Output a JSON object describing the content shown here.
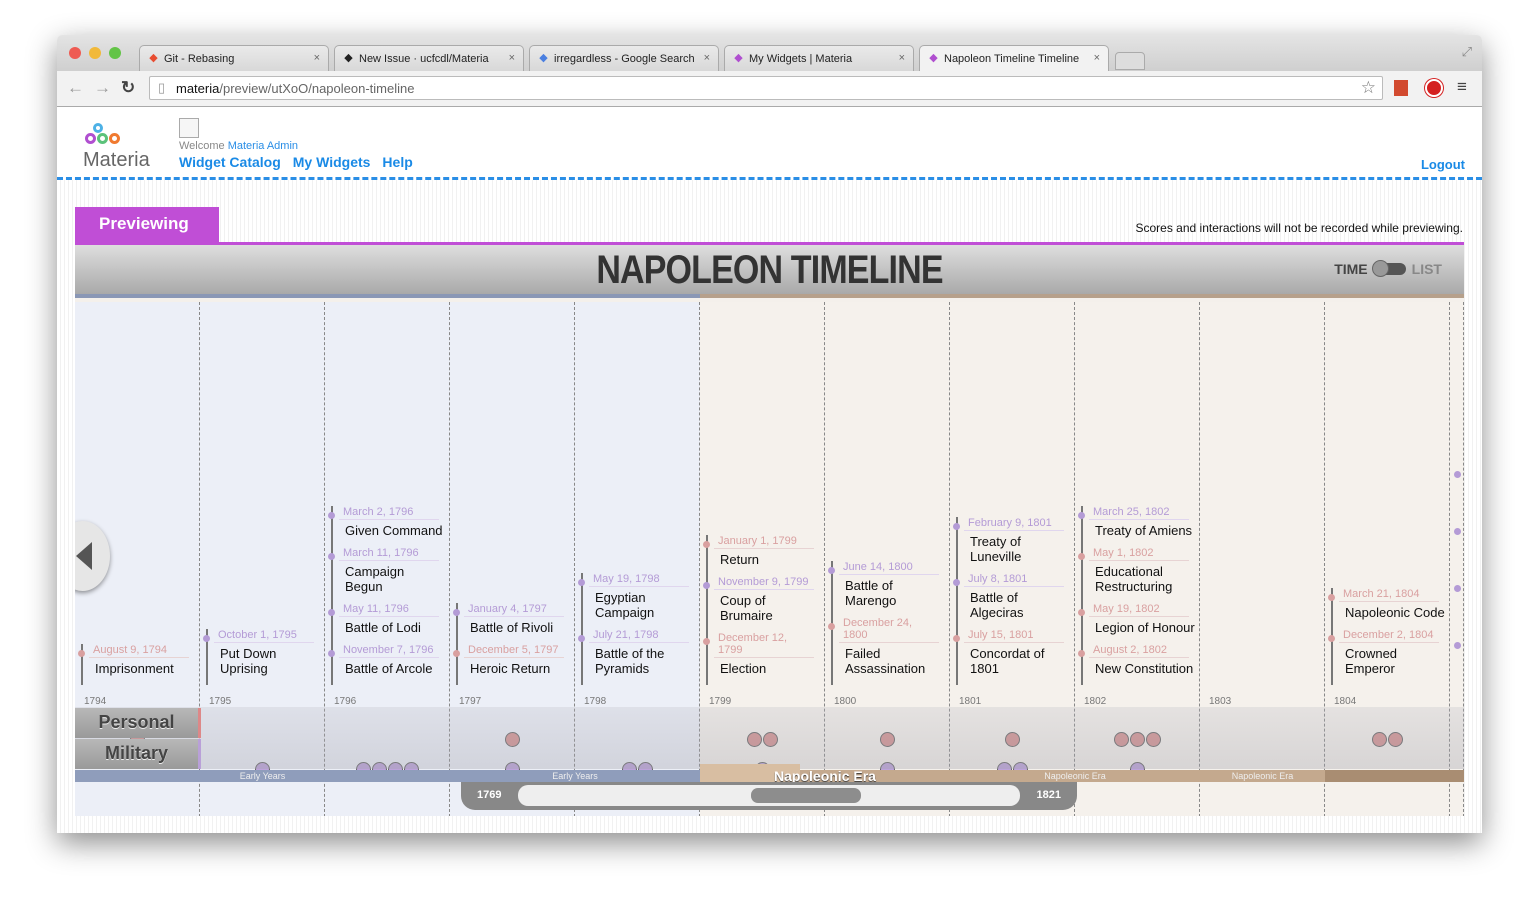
{
  "browser": {
    "tabs": [
      {
        "title": "Git - Rebasing",
        "icon": "git-icon",
        "color": "#e84d31"
      },
      {
        "title": "New Issue · ucfcdl/Materia",
        "icon": "github-icon",
        "color": "#222"
      },
      {
        "title": "irregardless - Google Search",
        "icon": "google-icon",
        "color": "#4a7fe0"
      },
      {
        "title": "My Widgets | Materia",
        "icon": "materia-icon",
        "color": "#b04fd0"
      },
      {
        "title": "Napoleon Timeline Timeline",
        "icon": "materia-icon",
        "color": "#b04fd0"
      }
    ],
    "url_host": "materia",
    "url_path": "/preview/utXoO/napoleon-timeline"
  },
  "site": {
    "logo": "Materia",
    "welcome": "Welcome",
    "user": "Materia Admin",
    "nav": [
      "Widget Catalog",
      "My Widgets",
      "Help"
    ],
    "logout": "Logout",
    "previewing": "Previewing",
    "preview_note": "Scores and interactions will not be recorded while previewing."
  },
  "widget": {
    "title": "NAPOLEON TIMELINE",
    "toggle_time": "TIME",
    "toggle_list": "LIST",
    "row_personal": "Personal",
    "row_military": "Military",
    "colors": {
      "personal": "#d59393",
      "military": "#bda3db",
      "early": "#8f9dbb",
      "napoleonic": "#c4a98e"
    },
    "years": [
      {
        "year": "1794",
        "era": "early",
        "events": [
          {
            "date": "August 9, 1794",
            "title": "Imprisonment",
            "type": "personal"
          }
        ]
      },
      {
        "year": "1795",
        "era": "early",
        "events": [
          {
            "date": "October 1, 1795",
            "title": "Put Down Uprising",
            "type": "military"
          }
        ]
      },
      {
        "year": "1796",
        "era": "early",
        "events": [
          {
            "date": "March 2, 1796",
            "title": "Given Command",
            "type": "military"
          },
          {
            "date": "March 11, 1796",
            "title": "Campaign Begun",
            "type": "military"
          },
          {
            "date": "May 11, 1796",
            "title": "Battle of Lodi",
            "type": "military"
          },
          {
            "date": "November 7, 1796",
            "title": "Battle of Arcole",
            "type": "military"
          }
        ]
      },
      {
        "year": "1797",
        "era": "early",
        "events": [
          {
            "date": "January 4, 1797",
            "title": "Battle of Rivoli",
            "type": "military"
          },
          {
            "date": "December 5, 1797",
            "title": "Heroic Return",
            "type": "personal"
          }
        ]
      },
      {
        "year": "1798",
        "era": "early",
        "events": [
          {
            "date": "May 19, 1798",
            "title": "Egyptian Campaign",
            "type": "military"
          },
          {
            "date": "July 21, 1798",
            "title": "Battle of the Pyramids",
            "type": "military"
          }
        ]
      },
      {
        "year": "1799",
        "era": "nap",
        "events": [
          {
            "date": "January 1, 1799",
            "title": "Return",
            "type": "personal"
          },
          {
            "date": "November 9, 1799",
            "title": "Coup of Brumaire",
            "type": "military"
          },
          {
            "date": "December 12, 1799",
            "title": "Election",
            "type": "personal"
          }
        ]
      },
      {
        "year": "1800",
        "era": "nap",
        "events": [
          {
            "date": "June 14, 1800",
            "title": "Battle of Marengo",
            "type": "military"
          },
          {
            "date": "December 24, 1800",
            "title": "Failed Assassination",
            "type": "personal"
          }
        ]
      },
      {
        "year": "1801",
        "era": "nap",
        "events": [
          {
            "date": "February 9, 1801",
            "title": "Treaty of Luneville",
            "type": "military"
          },
          {
            "date": "July 8, 1801",
            "title": "Battle of Algeciras",
            "type": "military"
          },
          {
            "date": "July 15, 1801",
            "title": "Concordat of 1801",
            "type": "personal"
          }
        ]
      },
      {
        "year": "1802",
        "era": "nap",
        "events": [
          {
            "date": "March 25, 1802",
            "title": "Treaty of Amiens",
            "type": "military"
          },
          {
            "date": "May 1, 1802",
            "title": "Educational Restructuring",
            "type": "personal"
          },
          {
            "date": "May 19, 1802",
            "title": "Legion of Honour",
            "type": "personal"
          },
          {
            "date": "August 2, 1802",
            "title": "New Constitution",
            "type": "personal"
          }
        ]
      },
      {
        "year": "1803",
        "era": "nap",
        "events": []
      },
      {
        "year": "1804",
        "era": "nap",
        "events": [
          {
            "date": "March 21, 1804",
            "title": "Napoleonic Code",
            "type": "personal"
          },
          {
            "date": "December 2, 1804",
            "title": "Crowned Emperor",
            "type": "personal"
          }
        ]
      }
    ],
    "eras": [
      {
        "label": "Early Years"
      },
      {
        "label": "Early Years"
      },
      {
        "label": "Napoleonic Era"
      },
      {
        "label": "Napoleonic Era"
      },
      {
        "label": "Napoleonic Era"
      }
    ],
    "scroll": {
      "start": "1769",
      "end": "1821"
    }
  }
}
